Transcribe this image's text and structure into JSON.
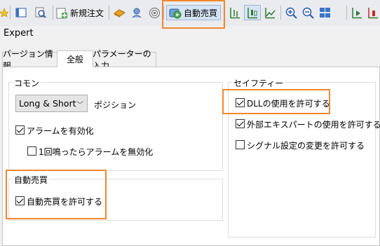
{
  "toolbar": {
    "new_order_label": "新規注文",
    "autotrading_label": "自動売買",
    "icons": [
      "star-icon",
      "window-icon",
      "search-chart-icon",
      "new-order-icon",
      "chart-gold-icon",
      "signal-icon",
      "radar-icon",
      "autotrading-icon",
      "bar-chart-icon",
      "candle-chart-icon",
      "line-chart-icon",
      "zoom-in-icon",
      "zoom-out-icon",
      "tile-icon",
      "scroll-icon",
      "shift-icon"
    ]
  },
  "window": {
    "title": "Expert"
  },
  "tabs": [
    {
      "label": "バージョン情報"
    },
    {
      "label": "全般"
    },
    {
      "label": "パラメーターの入力"
    }
  ],
  "common": {
    "title": "コモン",
    "position_value": "Long & Short",
    "position_label": "ポジション",
    "enable_alerts": {
      "label": "アラームを有効化",
      "checked": true
    },
    "disable_alert_once": {
      "label": "1回鳴ったらアラームを無効化",
      "checked": false
    }
  },
  "autotrading": {
    "title": "自動売買",
    "allow": {
      "label": "自動売買を許可する",
      "checked": true
    }
  },
  "safety": {
    "title": "セイフティー",
    "allow_dll": {
      "label": "DLLの使用を許可する",
      "checked": true
    },
    "allow_external_experts": {
      "label": "外部エキスパートの使用を許可する",
      "checked": true
    },
    "allow_signal_changes": {
      "label": "シグナル設定の変更を許可する",
      "checked": false
    }
  },
  "colors": {
    "highlight": "#f0872e"
  }
}
